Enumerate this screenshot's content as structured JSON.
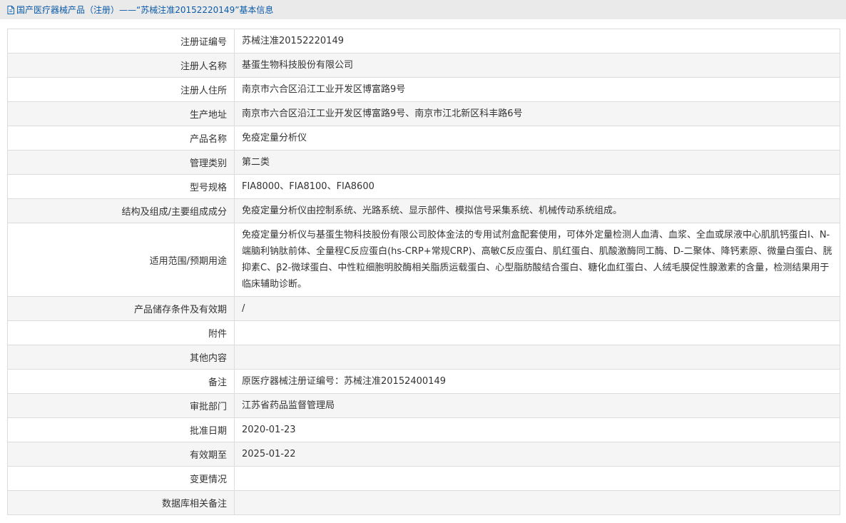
{
  "breadcrumb": {
    "icon": "document-icon",
    "text": "国产医疗器械产品（注册）——“苏械注准20152220149”基本信息"
  },
  "rows": [
    {
      "label": "注册证编号",
      "value": "苏械注准20152220149"
    },
    {
      "label": "注册人名称",
      "value": "基蛋生物科技股份有限公司"
    },
    {
      "label": "注册人住所",
      "value": "南京市六合区沿江工业开发区博富路9号"
    },
    {
      "label": "生产地址",
      "value": "南京市六合区沿江工业开发区博富路9号、南京市江北新区科丰路6号"
    },
    {
      "label": "产品名称",
      "value": "免疫定量分析仪"
    },
    {
      "label": "管理类别",
      "value": "第二类"
    },
    {
      "label": "型号规格",
      "value": "FIA8000、FIA8100、FIA8600"
    },
    {
      "label": "结构及组成/主要组成成分",
      "value": "免疫定量分析仪由控制系统、光路系统、显示部件、模拟信号采集系统、机械传动系统组成。"
    },
    {
      "label": "适用范围/预期用途",
      "value": "免疫定量分析仪与基蛋生物科技股份有限公司胶体金法的专用试剂盒配套使用，可体外定量检测人血清、血浆、全血或尿液中心肌肌钙蛋白I、N-端脑利钠肽前体、全量程C反应蛋白(hs-CRP+常规CRP)、高敏C反应蛋白、肌红蛋白、肌酸激酶同工酶、D-二聚体、降钙素原、微量白蛋白、胱抑素C、β2-微球蛋白、中性粒细胞明胶酶相关脂质运载蛋白、心型脂肪酸结合蛋白、糖化血红蛋白、人绒毛膜促性腺激素的含量，检测结果用于临床辅助诊断。"
    },
    {
      "label": "产品储存条件及有效期",
      "value": "/"
    },
    {
      "label": "附件",
      "value": ""
    },
    {
      "label": "其他内容",
      "value": ""
    },
    {
      "label": "备注",
      "value": "原医疗器械注册证编号：苏械注准20152400149"
    },
    {
      "label": "审批部门",
      "value": "江苏省药品监督管理局"
    },
    {
      "label": "批准日期",
      "value": "2020-01-23"
    },
    {
      "label": "有效期至",
      "value": "2025-01-22"
    },
    {
      "label": "变更情况",
      "value": ""
    },
    {
      "label": "数据库相关备注",
      "value": ""
    }
  ]
}
